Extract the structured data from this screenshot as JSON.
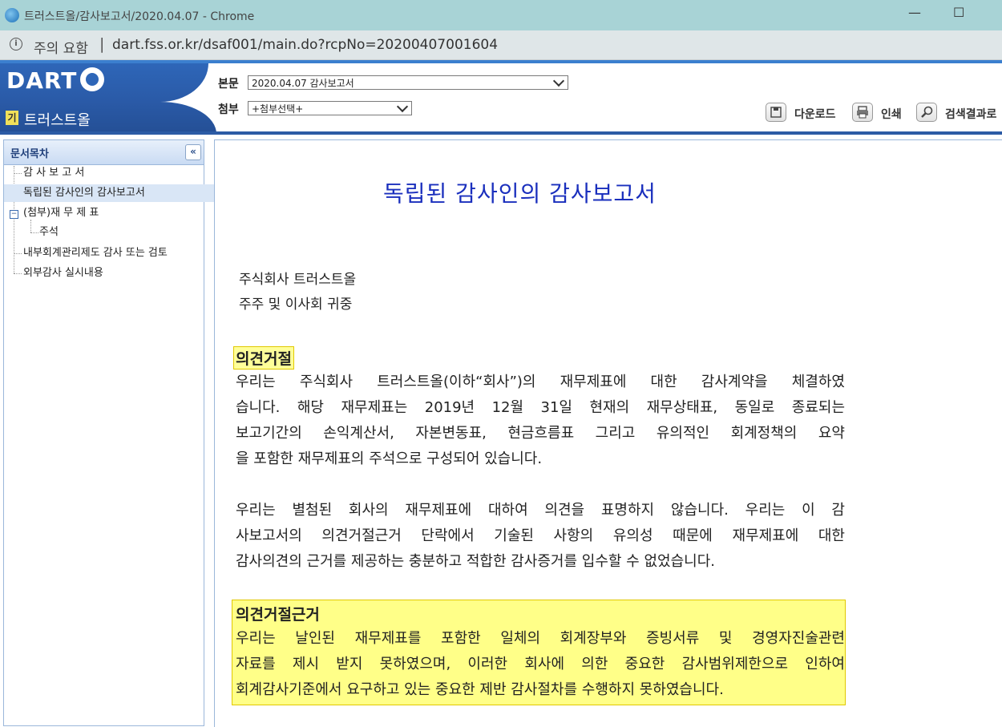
{
  "window": {
    "title": "트러스트올/감사보고서/2020.04.07 - Chrome",
    "controls": [
      "—",
      "☐"
    ]
  },
  "addressbar": {
    "security_label": "주의 요함",
    "separator": "|",
    "url": "dart.fss.or.kr/dsaf001/main.do?rcpNo=20200407001604"
  },
  "header": {
    "logo": "DART",
    "company_badge": "기",
    "company_name": "트러스트올",
    "main_label": "본문",
    "main_select": "2020.04.07  감사보고서",
    "attach_label": "첨부",
    "attach_select": "+첨부선택+",
    "tools": {
      "download": "다운로드",
      "print": "인쇄",
      "search_results": "검색결과로"
    }
  },
  "sidebar": {
    "title": "문서목차",
    "collapse": "«",
    "items": [
      "감 사 보 고 서",
      "독립된 감사인의 감사보고서",
      "(첨부)재 무 제 표",
      "주석",
      "내부회계관리제도 감사 또는 검토",
      "외부감사 실시내용"
    ],
    "expander": "−"
  },
  "document": {
    "title": "독립된 감사인의 감사보고서",
    "addressee": [
      "주식회사 트러스트올",
      "주주 및 이사회 귀중"
    ],
    "opinion_heading": "의견거절",
    "opinion_lines": [
      "우리는   주식회사 트러스트올(이하“회사”)의 재무제표에 대한 감사계약을 체결하였",
      "습니다. 해당 재무제표는 2019년 12월 31일 현재의 재무상태표, 동일로 종료되는",
      "보고기간의 손익계산서, 자본변동표, 현금흐름표 그리고 유의적인 회계정책의 요약",
      "을 포함한 재무제표의 주석으로 구성되어 있습니다."
    ],
    "disclaimer_lines": [
      "우리는 별첨된 회사의 재무제표에 대하여 의견을 표명하지 않습니다. 우리는 이 감",
      "사보고서의 의견거절근거 단락에서 기술된 사항의 유의성 때문에 재무제표에 대한",
      "감사의견의 근거를 제공하는 충분하고 적합한 감사증거를 입수할 수 없었습니다."
    ],
    "basis_heading": "의견거절근거",
    "basis_lines": [
      "우리는 날인된 재무제표를 포함한 일체의 회계장부와 증빙서류 및 경영자진술관련",
      "자료를 제시 받지 못하였으며, 이러한 회사에 의한 중요한 감사범위제한으로 인하여",
      "회계감사기준에서 요구하고 있는 중요한 제반 감사절차를 수행하지 못하였습니다."
    ]
  },
  "colors": {
    "title_blue": "#1a2fbd",
    "highlight_yellow": "#ffff88",
    "header_blue": "#2e66b8"
  }
}
